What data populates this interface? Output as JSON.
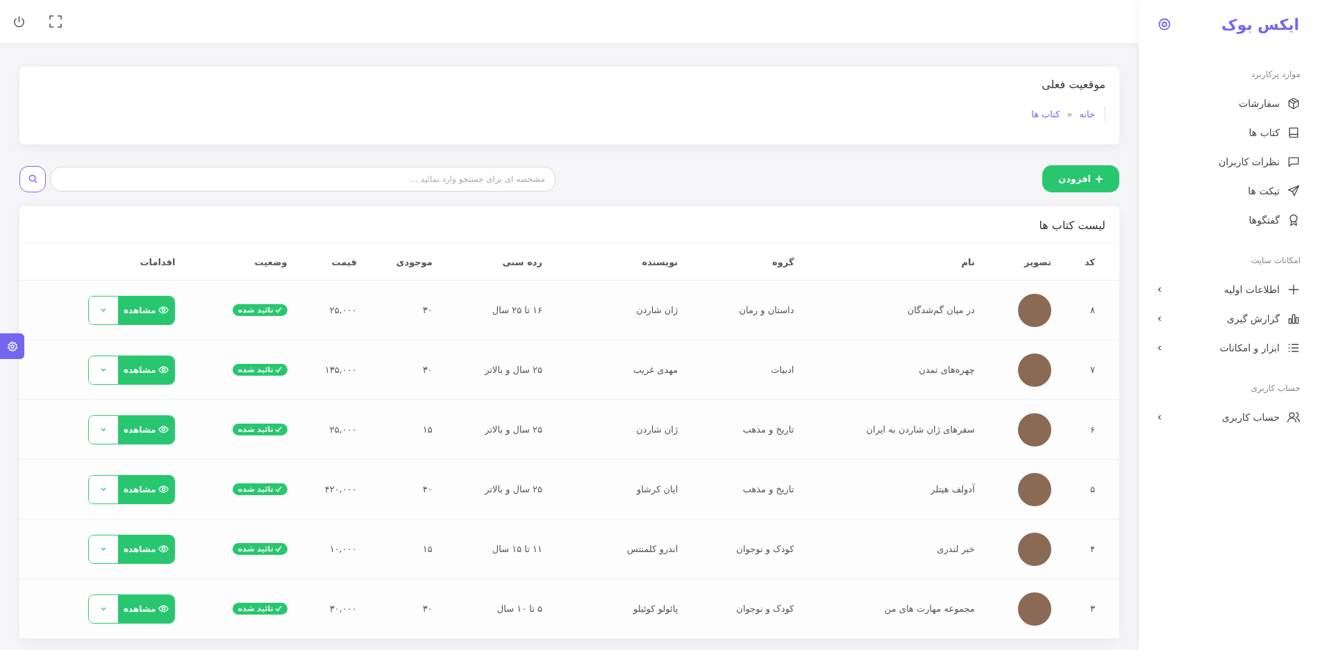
{
  "sidebar": {
    "logo": "ایکس بوک",
    "sections": [
      {
        "heading": "موارد پرکاربرد",
        "items": [
          {
            "label": "سفارشات",
            "kind": "link"
          },
          {
            "label": "کتاب ها",
            "kind": "link"
          },
          {
            "label": "نظرات کاربران",
            "kind": "link"
          },
          {
            "label": "تیکت ها",
            "kind": "link"
          },
          {
            "label": "گفتگوها",
            "kind": "link"
          }
        ]
      },
      {
        "heading": "امکانات سایت",
        "items": [
          {
            "label": "اطلاعات اولیه",
            "kind": "submenu"
          },
          {
            "label": "گزارش گیری",
            "kind": "submenu"
          },
          {
            "label": "ابزار و امکانات",
            "kind": "submenu"
          }
        ]
      },
      {
        "heading": "حساب کاربری",
        "items": [
          {
            "label": "حساب کاربری",
            "kind": "submenu"
          }
        ]
      }
    ]
  },
  "breadcrumb_card": {
    "title": "موقعیت فعلی",
    "crumbs": [
      "خانه",
      "کتاب ها"
    ],
    "separator": "«"
  },
  "toolbar": {
    "add_button": "افزودن",
    "search": {
      "placeholder": "مشخصه ای برای جستجو وارد نمائید ..."
    }
  },
  "table": {
    "title": "لیست کتاب ها",
    "columns": [
      "کد",
      "تصویر",
      "نام",
      "گروه",
      "نویسنده",
      "رده سنی",
      "موجودی",
      "قیمت",
      "وضعیت",
      "اقدامات"
    ],
    "rows": [
      {
        "code": "۸",
        "name": "در میان گم‌شدگان",
        "group": "داستان و رمان",
        "author": "ژان شاردن",
        "age_range": "۱۶ تا ۲۵ سال",
        "stock": "۳۰",
        "price": "۲۵,۰۰۰",
        "status": "تائید شده",
        "action": "مشاهده"
      },
      {
        "code": "۷",
        "name": "چهره‌های تمدن",
        "group": "ادبیات",
        "author": "مهدی غریب",
        "age_range": "۲۵ سال و بالاتر",
        "stock": "۳۰",
        "price": "۱۳۵,۰۰۰",
        "status": "تائید شده",
        "action": "مشاهده"
      },
      {
        "code": "۶",
        "name": "سفرهای ژان شاردن به ایران",
        "group": "تاریخ و مذهب",
        "author": "ژان شاردن",
        "age_range": "۲۵ سال و بالاتر",
        "stock": "۱۵",
        "price": "۲۵,۰۰۰",
        "status": "تائید شده",
        "action": "مشاهده"
      },
      {
        "code": "۵",
        "name": "آدولف هیتلر",
        "group": "تاریخ و مذهب",
        "author": "ایان کرشاو",
        "age_range": "۲۵ سال و بالاتر",
        "stock": "۴۰",
        "price": "۴۲۰,۰۰۰",
        "status": "تائید شده",
        "action": "مشاهده"
      },
      {
        "code": "۴",
        "name": "خبر لندری",
        "group": "کودک و نوجوان",
        "author": "اندرو کلمنتس",
        "age_range": "۱۱ تا ۱۵ سال",
        "stock": "۱۵",
        "price": "۱۰,۰۰۰",
        "status": "تائید شده",
        "action": "مشاهده"
      },
      {
        "code": "۳",
        "name": "مجموعه مهارت های من",
        "group": "کودک و نوجوان",
        "author": "پائولو کوئیلو",
        "age_range": "۵ تا ۱۰ سال",
        "stock": "۳۰",
        "price": "۳۰,۰۰۰",
        "status": "تائید شده",
        "action": "مشاهده"
      }
    ]
  }
}
